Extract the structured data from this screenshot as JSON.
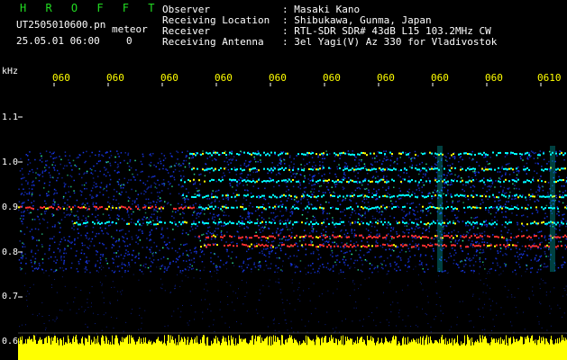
{
  "header": {
    "logo": "H R O F F T",
    "filename": "UT2505010600.pn",
    "datetime": "25.05.01 06:00",
    "meteor_label": "meteor",
    "meteor_count": "0",
    "fields": [
      {
        "label": "Observer",
        "value": ": Masaki Kano"
      },
      {
        "label": "Receiving Location",
        "value": ": Shibukawa, Gunma, Japan"
      },
      {
        "label": "Receiver",
        "value": ": RTL-SDR SDR# 43dB L15 103.2MHz CW"
      },
      {
        "label": "Receiving Antenna",
        "value": ": 3el Yagi(V) Az 330 for Vladivostok"
      }
    ]
  },
  "axes": {
    "y_unit": "kHz",
    "y_ticks": [
      "1.1",
      "1.0",
      "0.9",
      "0.8",
      "0.7",
      "0.6"
    ],
    "x_ticks": [
      "060",
      "060",
      "060",
      "060",
      "060",
      "060",
      "060",
      "060",
      "060",
      "0610"
    ]
  },
  "colors": {
    "background": "#000000",
    "noise": "#1a3cff",
    "signal": "#00ffff",
    "strong": "#ff3030",
    "amplitude": "#ffff00"
  }
}
